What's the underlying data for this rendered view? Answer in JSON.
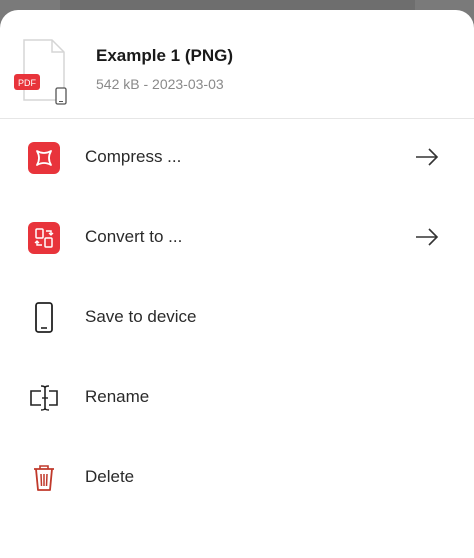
{
  "file": {
    "name": "Example 1 (PNG)",
    "meta": "542 kB - 2023-03-03",
    "badge": "PDF"
  },
  "menu": {
    "items": [
      {
        "id": "compress",
        "label": "Compress ...",
        "icon": "compress-icon",
        "has_arrow": true
      },
      {
        "id": "convert",
        "label": "Convert to ...",
        "icon": "convert-icon",
        "has_arrow": true
      },
      {
        "id": "save",
        "label": "Save to device",
        "icon": "phone-icon",
        "has_arrow": false
      },
      {
        "id": "rename",
        "label": "Rename",
        "icon": "rename-icon",
        "has_arrow": false
      },
      {
        "id": "delete",
        "label": "Delete",
        "icon": "trash-icon",
        "has_arrow": false
      }
    ]
  },
  "colors": {
    "accent": "#e8343b",
    "delete": "#c0392b",
    "text": "#2a2a2a",
    "muted": "#8a8a8a"
  }
}
